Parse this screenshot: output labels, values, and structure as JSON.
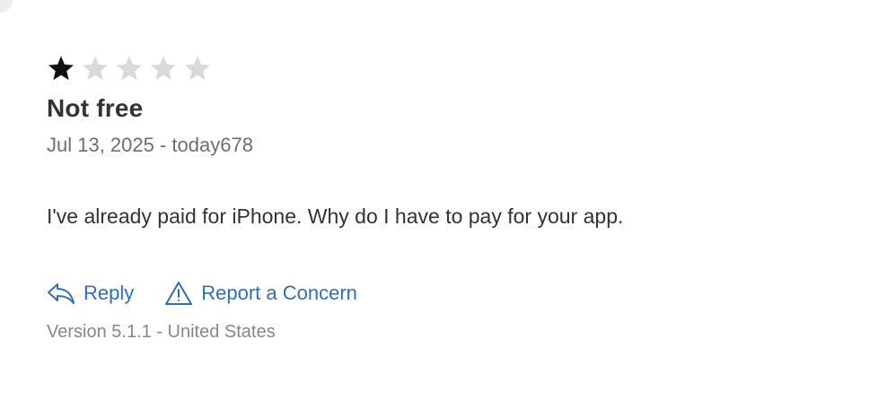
{
  "review": {
    "rating": 1,
    "max_rating": 5,
    "title": "Not free",
    "meta": "Jul 13, 2025 - today678",
    "body": "I've already paid for iPhone. Why do I have to pay for your app.",
    "version_line": "Version 5.1.1 - United States"
  },
  "actions": {
    "reply_label": "Reply",
    "reply_icon": "reply-arrow-icon",
    "report_label": "Report a Concern",
    "report_icon": "warning-triangle-icon"
  },
  "colors": {
    "star_filled": "#111111",
    "star_empty": "#d9d9d9",
    "link": "#2f6fb8",
    "meta_text": "#6e6e73"
  }
}
